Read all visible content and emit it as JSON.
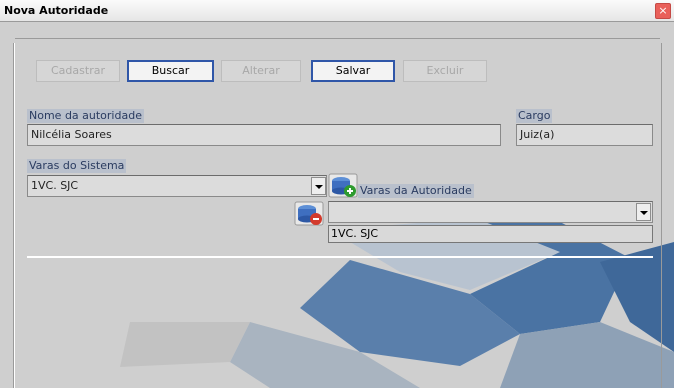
{
  "window": {
    "title": "Nova Autoridade"
  },
  "toolbar": {
    "cadastrar": "Cadastrar",
    "buscar": "Buscar",
    "alterar": "Alterar",
    "salvar": "Salvar",
    "excluir": "Excluir"
  },
  "form": {
    "nome_label": "Nome da autoridade",
    "nome_value": "Nilcélia Soares",
    "cargo_label": "Cargo",
    "cargo_value": "Juiz(a)",
    "varas_sistema_label": "Varas do Sistema",
    "varas_sistema_value": "1VC. SJC",
    "varas_autoridade_label": "Varas da Autoridade",
    "varas_autoridade_value": "",
    "varas_autoridade_items": [
      "1VC. SJC"
    ]
  },
  "colors": {
    "accent": "#2f56a8",
    "label_bg": "#b9c0cc",
    "shape": "#4a73a3"
  },
  "icons": {
    "close": "close-icon",
    "add": "add-vara-icon",
    "remove": "remove-vara-icon"
  }
}
